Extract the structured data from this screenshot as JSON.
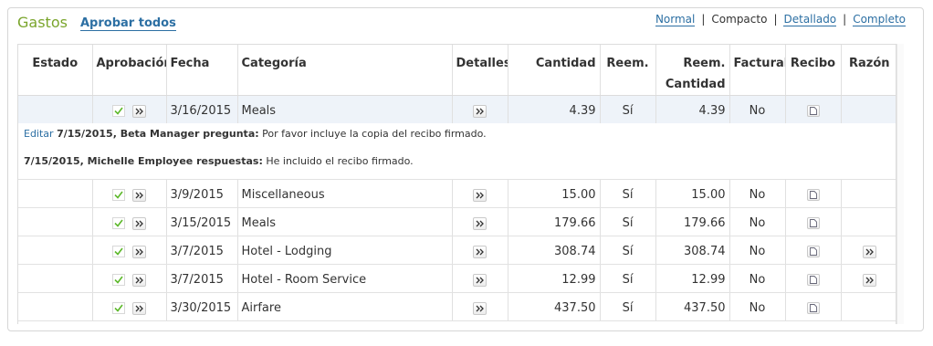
{
  "section": {
    "title": "Gastos",
    "approve_all": "Aprobar todos"
  },
  "views": {
    "normal": "Normal",
    "compact": "Compacto",
    "detailed": "Detallado",
    "complete": "Completo",
    "separator": "|"
  },
  "columns": {
    "estado": "Estado",
    "aprobacion": "Aprobación",
    "fecha": "Fecha",
    "categoria": "Categoría",
    "detalles": "Detalles",
    "cantidad": "Cantidad",
    "reem": "Reem.",
    "reem_cantidad_1": "Reem.",
    "reem_cantidad_2": "Cantidad",
    "facturable": "Facturab",
    "recibo": "Recibo",
    "razon": "Razón"
  },
  "rows": [
    {
      "fecha": "3/16/2015",
      "categoria": "Meals",
      "cantidad": "4.39",
      "reem": "Sí",
      "reem_cantidad": "4.39",
      "facturable": "No"
    },
    {
      "fecha": "3/9/2015",
      "categoria": "Miscellaneous",
      "cantidad": "15.00",
      "reem": "Sí",
      "reem_cantidad": "15.00",
      "facturable": "No"
    },
    {
      "fecha": "3/15/2015",
      "categoria": "Meals",
      "cantidad": "179.66",
      "reem": "Sí",
      "reem_cantidad": "179.66",
      "facturable": "No"
    },
    {
      "fecha": "3/7/2015",
      "categoria": "Hotel - Lodging",
      "cantidad": "308.74",
      "reem": "Sí",
      "reem_cantidad": "308.74",
      "facturable": "No"
    },
    {
      "fecha": "3/7/2015",
      "categoria": "Hotel - Room Service",
      "cantidad": "12.99",
      "reem": "Sí",
      "reem_cantidad": "12.99",
      "facturable": "No"
    },
    {
      "fecha": "3/30/2015",
      "categoria": "Airfare",
      "cantidad": "437.50",
      "reem": "Sí",
      "reem_cantidad": "437.50",
      "facturable": "No"
    }
  ],
  "notes": {
    "edit": "Editar",
    "line1_author": "7/15/2015, Beta Manager pregunta:",
    "line1_text": " Por favor incluye la copia del recibo firmado.",
    "line2_author": "7/15/2015, Michelle Employee respuestas:",
    "line2_text": " He incluido el recibo firmado."
  },
  "icons": {
    "approve": "check-icon",
    "details": "double-chevron-right-icon",
    "receipt": "document-icon"
  },
  "colors": {
    "title": "#7aa52c",
    "link": "#2c6fa3",
    "selected_row": "#eef3f9",
    "check": "#5cb82a"
  }
}
